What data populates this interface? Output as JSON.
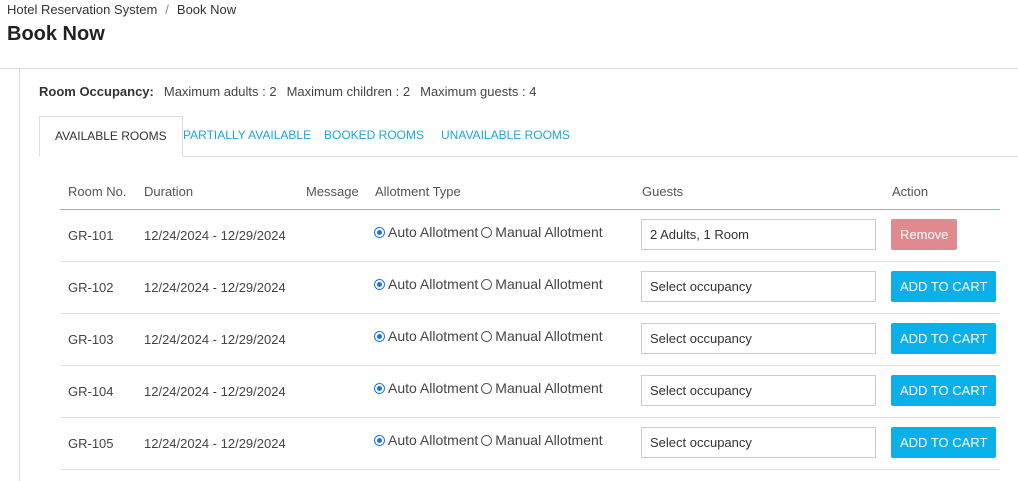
{
  "breadcrumb": {
    "root": "Hotel Reservation System",
    "separator": "/",
    "current": "Book Now"
  },
  "page_title": "Book Now",
  "occupancy": {
    "label": "Room Occupancy:",
    "max_adults": "Maximum adults : 2",
    "max_children": "Maximum children : 2",
    "max_guests": "Maximum guests : 4"
  },
  "tabs": [
    {
      "label": "AVAILABLE ROOMS",
      "active": true
    },
    {
      "label": "PARTIALLY AVAILABLE",
      "active": false
    },
    {
      "label": "BOOKED ROOMS",
      "active": false
    },
    {
      "label": "UNAVAILABLE ROOMS",
      "active": false
    }
  ],
  "table": {
    "headers": {
      "room_no": "Room No.",
      "duration": "Duration",
      "message": "Message",
      "allotment_type": "Allotment Type",
      "guests": "Guests",
      "action": "Action"
    },
    "allotment_options": {
      "auto": "Auto Allotment",
      "manual": "Manual Allotment"
    },
    "rows": [
      {
        "room": "GR-101",
        "duration": "12/24/2024 - 12/29/2024",
        "guests": "2 Adults, 1 Room",
        "action": "Remove"
      },
      {
        "room": "GR-102",
        "duration": "12/24/2024 - 12/29/2024",
        "guests": "Select occupancy",
        "action": "ADD TO CART"
      },
      {
        "room": "GR-103",
        "duration": "12/24/2024 - 12/29/2024",
        "guests": "Select occupancy",
        "action": "ADD TO CART"
      },
      {
        "room": "GR-104",
        "duration": "12/24/2024 - 12/29/2024",
        "guests": "Select occupancy",
        "action": "ADD TO CART"
      },
      {
        "room": "GR-105",
        "duration": "12/24/2024 - 12/29/2024",
        "guests": "Select occupancy",
        "action": "ADD TO CART"
      }
    ]
  },
  "colors": {
    "accent": "#0ab0ea",
    "remove": "#e08a8f",
    "tab_link": "#1aa6d9"
  }
}
